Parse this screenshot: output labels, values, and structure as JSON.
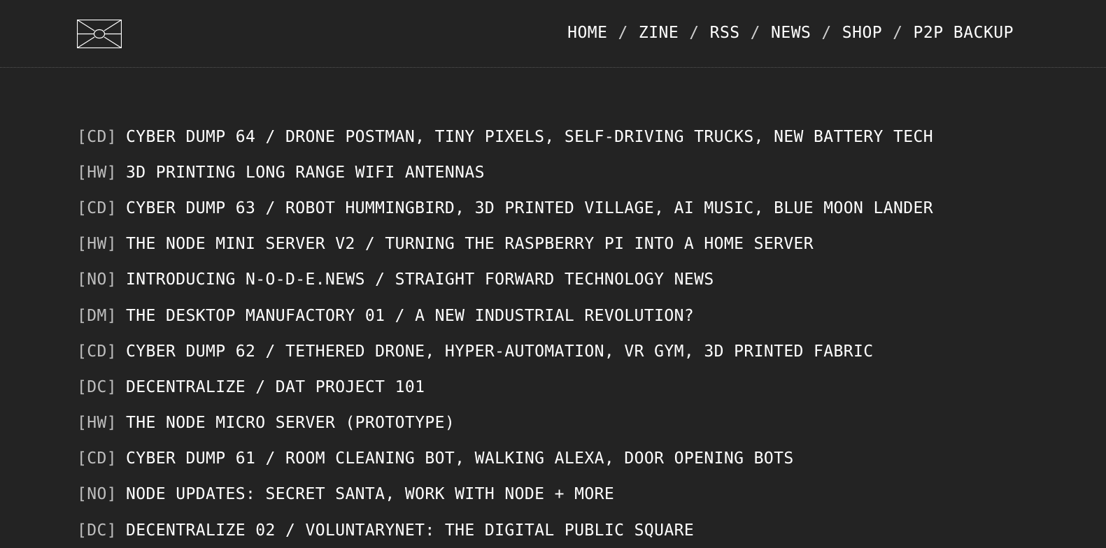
{
  "nav": {
    "items": [
      "HOME",
      "ZINE",
      "RSS",
      "NEWS",
      "SHOP",
      "P2P BACKUP"
    ],
    "separator": "/"
  },
  "posts": [
    {
      "tag": "[CD]",
      "title": "CYBER DUMP 64 / DRONE POSTMAN, TINY PIXELS, SELF-DRIVING TRUCKS, NEW BATTERY TECH"
    },
    {
      "tag": "[HW]",
      "title": "3D PRINTING LONG RANGE WIFI ANTENNAS"
    },
    {
      "tag": "[CD]",
      "title": "CYBER DUMP 63 / ROBOT HUMMINGBIRD, 3D PRINTED VILLAGE, AI MUSIC, BLUE MOON LANDER"
    },
    {
      "tag": "[HW]",
      "title": "THE NODE MINI SERVER V2 / TURNING THE RASPBERRY PI INTO A HOME SERVER"
    },
    {
      "tag": "[NO]",
      "title": "INTRODUCING N-O-D-E.NEWS / STRAIGHT FORWARD TECHNOLOGY NEWS"
    },
    {
      "tag": "[DM]",
      "title": "THE DESKTOP MANUFACTORY 01 / A NEW INDUSTRIAL REVOLUTION?"
    },
    {
      "tag": "[CD]",
      "title": "CYBER DUMP 62 / TETHERED DRONE, HYPER-AUTOMATION, VR GYM, 3D PRINTED FABRIC"
    },
    {
      "tag": "[DC]",
      "title": "DECENTRALIZE / DAT PROJECT 101"
    },
    {
      "tag": "[HW]",
      "title": "THE NODE MICRO SERVER (PROTOTYPE)"
    },
    {
      "tag": "[CD]",
      "title": "CYBER DUMP 61 / ROOM CLEANING BOT, WALKING ALEXA, DOOR OPENING BOTS"
    },
    {
      "tag": "[NO]",
      "title": "NODE UPDATES: SECRET SANTA, WORK WITH NODE + MORE"
    },
    {
      "tag": "[DC]",
      "title": "DECENTRALIZE 02 / VOLUNTARYNET: THE DIGITAL PUBLIC SQUARE"
    }
  ],
  "icons": {
    "logo": "node-logo-icon"
  }
}
